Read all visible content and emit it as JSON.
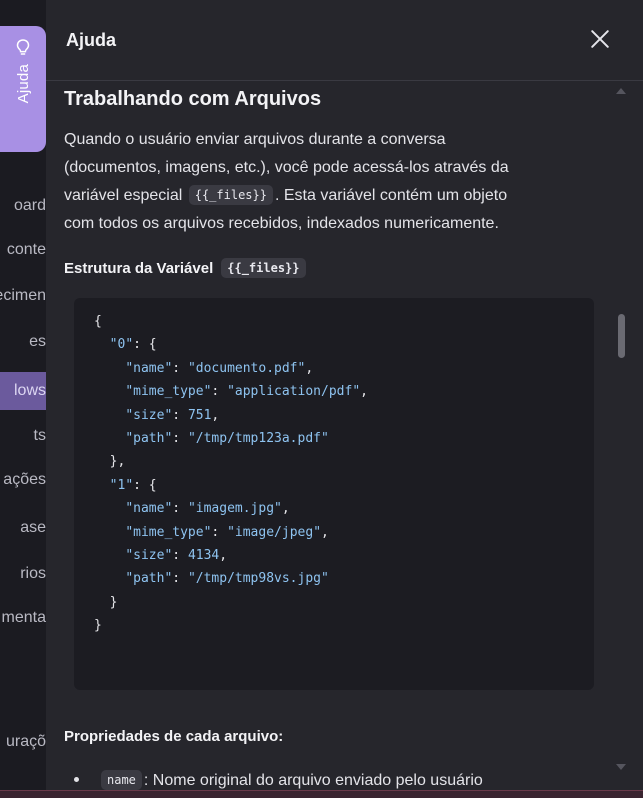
{
  "background_nav": {
    "items": [
      {
        "label": "oard",
        "active": false
      },
      {
        "label": "conte",
        "active": false
      },
      {
        "label": "ecimen",
        "active": false
      },
      {
        "label": "es",
        "active": false
      },
      {
        "label": "lows",
        "active": true
      },
      {
        "label": "ts",
        "active": false
      },
      {
        "label": "ações",
        "active": false
      },
      {
        "label": "ase",
        "active": false
      },
      {
        "label": "rios",
        "active": false
      },
      {
        "label": "menta",
        "active": false
      },
      {
        "label": "uraçõ",
        "active": false
      }
    ]
  },
  "help_tab": {
    "label": "Ajuda",
    "icon": "lightbulb-icon",
    "color": "#a890e4"
  },
  "panel": {
    "title": "Ajuda",
    "close_icon": "close-icon",
    "section_title": "Trabalhando com Arquivos",
    "paragraph": {
      "line1": "Quando o usuário enviar arquivos durante a conversa",
      "line2": "(documentos, imagens, etc.), você pode acessá-los através da",
      "line3_before": "variável especial",
      "line3_code": "{{_files}}",
      "line3_after": ". Esta variável contém um objeto",
      "line4": "com todos os arquivos recebidos, indexados numericamente."
    },
    "subhead": {
      "text": "Estrutura da Variável",
      "code": "{{_files}}"
    },
    "code_example": {
      "file0": {
        "index": "0",
        "name": "documento.pdf",
        "mime_type": "application/pdf",
        "size": "751",
        "path": "/tmp/tmp123a.pdf"
      },
      "file1": {
        "index": "1",
        "name": "imagem.jpg",
        "mime_type": "image/jpeg",
        "size": "4134",
        "path": "/tmp/tmp98vs.jpg"
      },
      "keys": {
        "name": "name",
        "mime_type": "mime_type",
        "size": "size",
        "path": "path"
      }
    },
    "props_heading": "Propriedades de cada arquivo:",
    "props_first_item": {
      "code": "name",
      "text": ": Nome original do arquivo enviado pelo usuário"
    }
  },
  "colors": {
    "panel_bg": "#26262c",
    "code_bg": "#1c1c22",
    "code_token": "#8ec3f0",
    "nav_active": "#6b5a9d"
  }
}
